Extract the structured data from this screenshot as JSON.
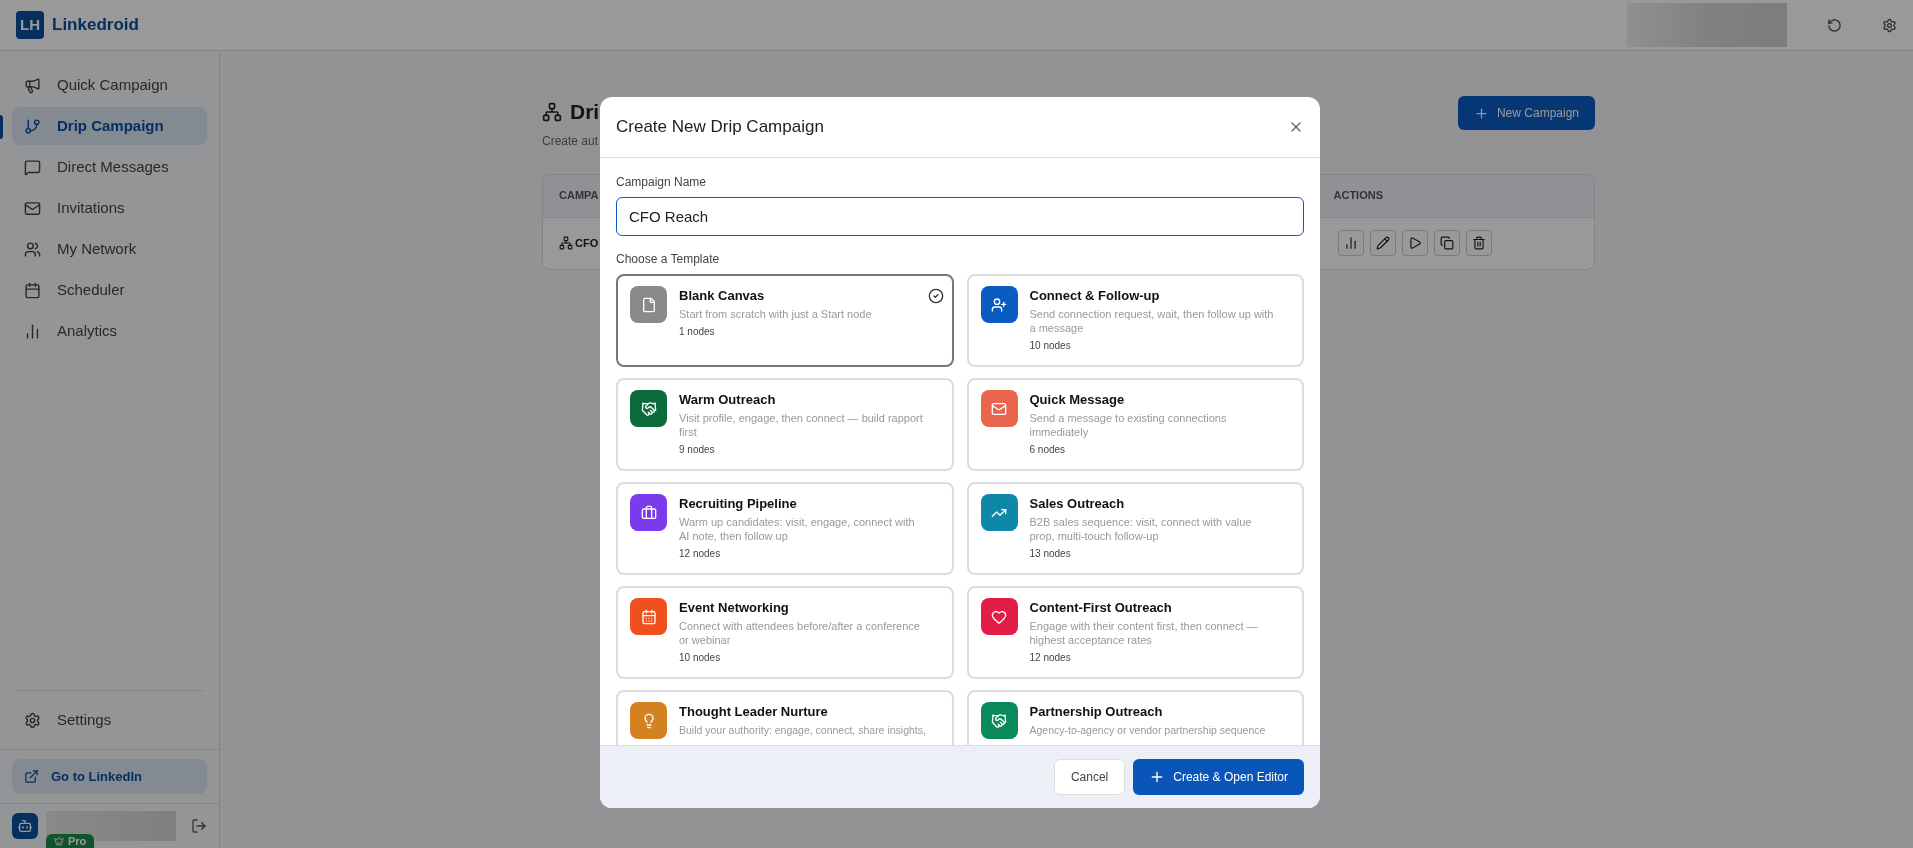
{
  "app": {
    "name": "Linkedroid",
    "logo": "LH"
  },
  "sidebar": {
    "items": [
      {
        "label": "Quick Campaign",
        "kind": "quick",
        "selected": false
      },
      {
        "label": "Drip Campaign",
        "kind": "drip",
        "selected": true
      },
      {
        "label": "Direct Messages",
        "kind": "messages",
        "selected": false
      },
      {
        "label": "Invitations",
        "kind": "invitations",
        "selected": false
      },
      {
        "label": "My Network",
        "kind": "network",
        "selected": false
      },
      {
        "label": "Scheduler",
        "kind": "scheduler",
        "selected": false
      },
      {
        "label": "Analytics",
        "kind": "analytics",
        "selected": false
      }
    ],
    "settings": "Settings",
    "linkedin_link": "Go to LinkedIn",
    "plan_badge": "Pro"
  },
  "page": {
    "title": "Dri",
    "subtitle": "Create aut",
    "new_button": "New Campaign",
    "table": {
      "columns": [
        "CAMPA",
        "ACTIONS"
      ],
      "rows": [
        {
          "name": "CFO"
        }
      ]
    }
  },
  "dialog": {
    "title": "Create New Drip Campaign",
    "name_label": "Campaign Name",
    "name_value": "CFO Reach",
    "template_label": "Choose a Template",
    "templates": [
      {
        "kind": "blank",
        "color": "#8a8a8a",
        "title": "Blank Canvas",
        "description": "Start from scratch with just a Start node",
        "nodes": "1 nodes",
        "selected": true
      },
      {
        "kind": "connect",
        "color": "#0a5cc2",
        "title": "Connect & Follow-up",
        "description": "Send connection request, wait, then follow up with a message",
        "nodes": "10 nodes",
        "selected": false
      },
      {
        "kind": "warm",
        "color": "#0b6b3a",
        "title": "Warm Outreach",
        "description": "Visit profile, engage, then connect — build rapport first",
        "nodes": "9 nodes",
        "selected": false
      },
      {
        "kind": "message",
        "color": "#e8654e",
        "title": "Quick Message",
        "description": "Send a message to existing connections immediately",
        "nodes": "6 nodes",
        "selected": false
      },
      {
        "kind": "recruiting",
        "color": "#7c3aed",
        "title": "Recruiting Pipeline",
        "description": "Warm up candidates: visit, engage, connect with AI note, then follow up",
        "nodes": "12 nodes",
        "selected": false
      },
      {
        "kind": "sales",
        "color": "#0e87a8",
        "title": "Sales Outreach",
        "description": "B2B sales sequence: visit, connect with value prop, multi-touch follow-up",
        "nodes": "13 nodes",
        "selected": false
      },
      {
        "kind": "event",
        "color": "#f0501e",
        "title": "Event Networking",
        "description": "Connect with attendees before/after a conference or webinar",
        "nodes": "10 nodes",
        "selected": false
      },
      {
        "kind": "content",
        "color": "#e11d48",
        "title": "Content-First Outreach",
        "description": "Engage with their content first, then connect — highest acceptance rates",
        "nodes": "12 nodes",
        "selected": false
      },
      {
        "kind": "thought",
        "color": "#d4821f",
        "title": "Thought Leader Nurture",
        "description": "Build your authority: engage, connect, share insights,",
        "selected": false
      },
      {
        "kind": "partner",
        "color": "#0a8a5a",
        "title": "Partnership Outreach",
        "description": "Agency-to-agency or vendor partnership sequence",
        "selected": false
      }
    ],
    "cancel": "Cancel",
    "create": "Create & Open Editor"
  }
}
